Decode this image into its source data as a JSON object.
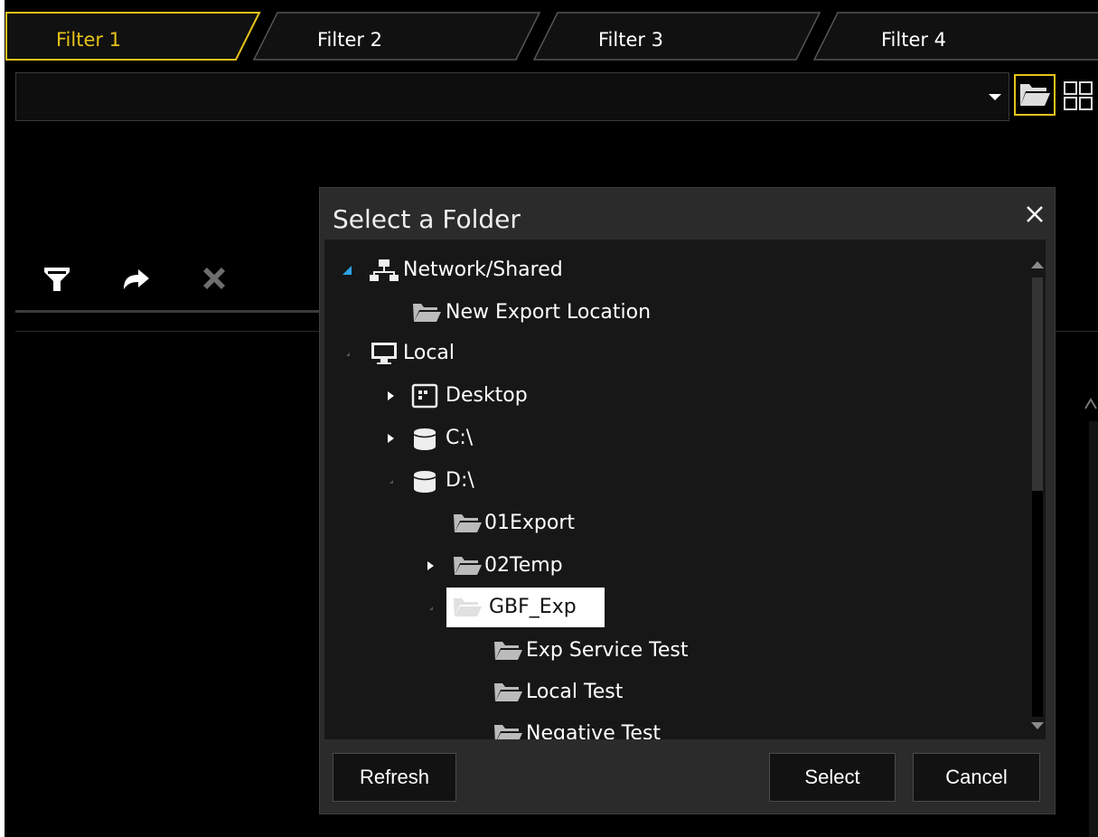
{
  "tabs": [
    {
      "label": "Filter 1",
      "active": true
    },
    {
      "label": "Filter 2",
      "active": false
    },
    {
      "label": "Filter 3",
      "active": false
    },
    {
      "label": "Filter 4",
      "active": false
    }
  ],
  "path_input": {
    "value": ""
  },
  "colors": {
    "accent": "#e6c21a",
    "background": "#000000",
    "dialog": "#2b2b2b",
    "tree": "#171717"
  },
  "toolbar": {
    "icons": [
      "filter-icon",
      "redo-icon",
      "clear-icon"
    ]
  },
  "dialog": {
    "title": "Select a Folder",
    "close_icon": "close-icon",
    "tree": [
      {
        "label": "Network/Shared",
        "icon": "network-icon",
        "expander": "expanded"
      },
      {
        "label": "New Export Location",
        "icon": "folder-icon",
        "expander": "none"
      },
      {
        "label": "Local",
        "icon": "monitor-icon",
        "expander": "expanded"
      },
      {
        "label": "Desktop",
        "icon": "desktop-icon",
        "expander": "collapsed"
      },
      {
        "label": "C:\\",
        "icon": "drive-icon",
        "expander": "collapsed"
      },
      {
        "label": "D:\\",
        "icon": "drive-icon",
        "expander": "expanded"
      },
      {
        "label": "01Export",
        "icon": "folder-icon",
        "expander": "none"
      },
      {
        "label": "02Temp",
        "icon": "folder-icon",
        "expander": "collapsed"
      },
      {
        "label": "GBF_Exp",
        "icon": "folder-icon",
        "expander": "expanded",
        "selected": true
      },
      {
        "label": "Exp Service Test",
        "icon": "folder-icon",
        "expander": "none"
      },
      {
        "label": "Local Test",
        "icon": "folder-icon",
        "expander": "none"
      },
      {
        "label": "Negative Test",
        "icon": "folder-icon",
        "expander": "none"
      }
    ],
    "buttons": {
      "refresh": "Refresh",
      "select": "Select",
      "cancel": "Cancel"
    }
  }
}
